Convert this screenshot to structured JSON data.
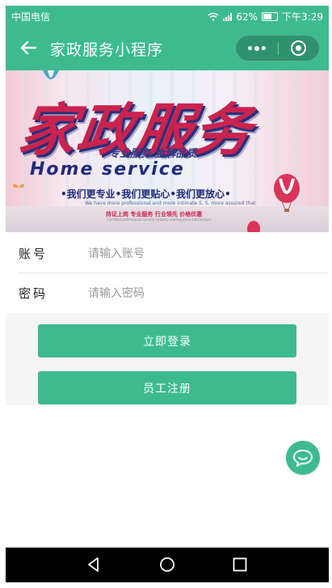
{
  "status_bar": {
    "carrier": "中国电信",
    "battery_percent": "62%",
    "time": "下午3:29"
  },
  "nav": {
    "title": "家政服务小程序",
    "back_icon": "arrow-left-icon",
    "menu_icon": "more-dots-icon",
    "close_icon": "target-circle-icon"
  },
  "banner": {
    "title": "家政服务",
    "subtitle": "专业服务 金牌品质",
    "english": "Home service",
    "slogan": "•我们更专业•我们更贴心•我们更放心•",
    "small_text": "We have more professional and more intimate S. S. more assured that",
    "tagline": "持证上岗 专业服务 行业领先 价格优惠",
    "tiny_text": "Certified professional service industry leading price concessions"
  },
  "form": {
    "account_label": "账号",
    "account_placeholder": "请输入账号",
    "password_label": "密码",
    "password_placeholder": "请输入密码"
  },
  "actions": {
    "login_label": "立即登录",
    "register_label": "员工注册"
  },
  "colors": {
    "primary": "#3dbb8f",
    "banner_red": "#c9234e",
    "banner_navy": "#1f2b7a"
  },
  "fab": {
    "icon": "chat-bubble-icon"
  },
  "system_nav": {
    "back_icon": "triangle-back-icon",
    "home_icon": "circle-home-icon",
    "recents_icon": "square-recents-icon"
  }
}
